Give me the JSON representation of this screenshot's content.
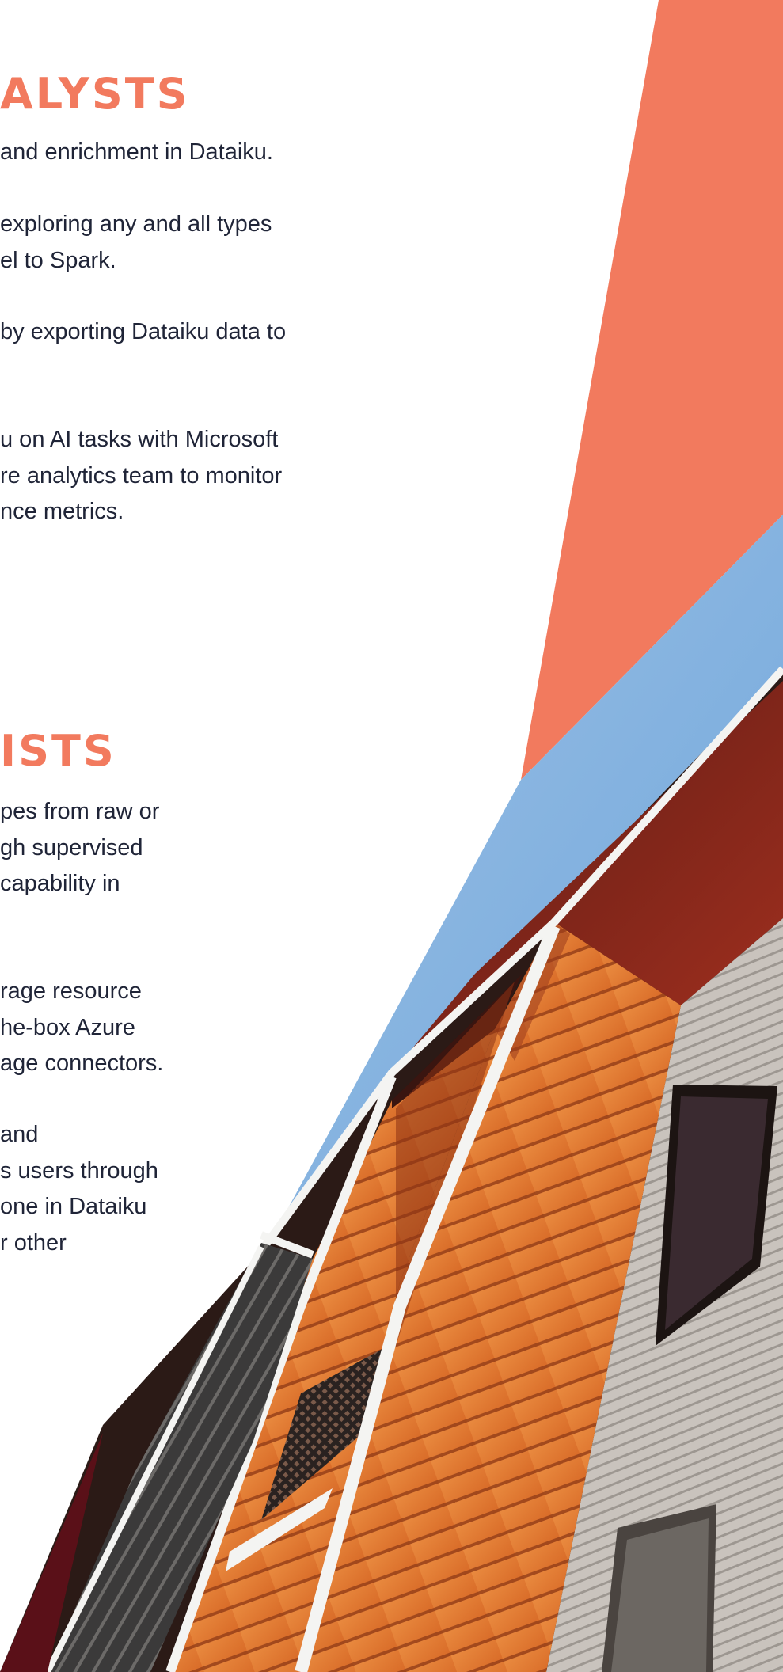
{
  "colors": {
    "accent_orange": "#f27a5e",
    "sky_blue": "#7faedd",
    "text_navy": "#1f2437",
    "cladding_orange": "#e07a35"
  },
  "section_analysts": {
    "heading": "ALYSTS",
    "paragraphs": [
      [
        "and enrichment in Dataiku."
      ],
      [
        "exploring any and all types",
        "el to Spark."
      ],
      [
        "by exporting Dataiku data to"
      ],
      [
        "u on AI tasks with Microsoft",
        "re analytics team to monitor",
        "nce metrics."
      ]
    ]
  },
  "section_scientists": {
    "heading": "ISTS",
    "paragraphs": [
      [
        "pes from raw or",
        "gh supervised",
        "capability in"
      ],
      [
        "rage resource",
        "he-box Azure",
        "age connectors."
      ],
      [
        "and",
        "s users through",
        "one in Dataiku",
        "r other"
      ]
    ]
  },
  "photo": {
    "icon": "building-facade-photo"
  }
}
